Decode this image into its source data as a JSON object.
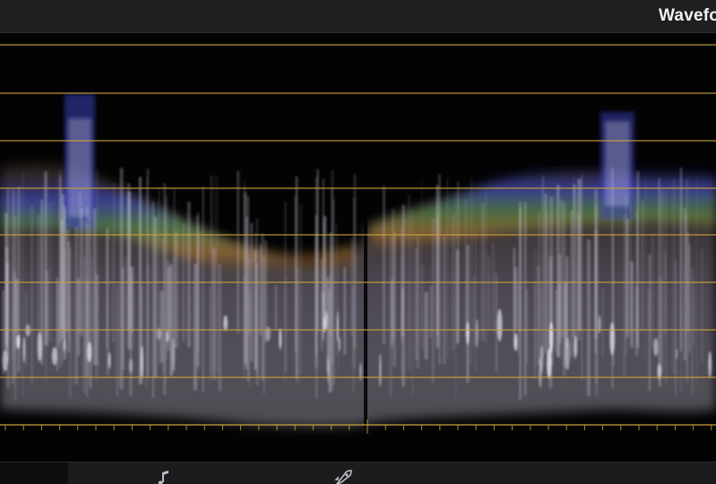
{
  "window": {
    "title": "Waveform"
  },
  "scope": {
    "graticule_color": "#c9a43a",
    "trace_colors": {
      "highlight": "#f4f1ff",
      "luma": "#d8d2e4",
      "blue": "#3a40b8",
      "green": "#4f8a45",
      "orange": "#a06a2c"
    }
  },
  "bottom_toolbar": {
    "icons": [
      "music-note-icon",
      "rocket-icon"
    ]
  }
}
